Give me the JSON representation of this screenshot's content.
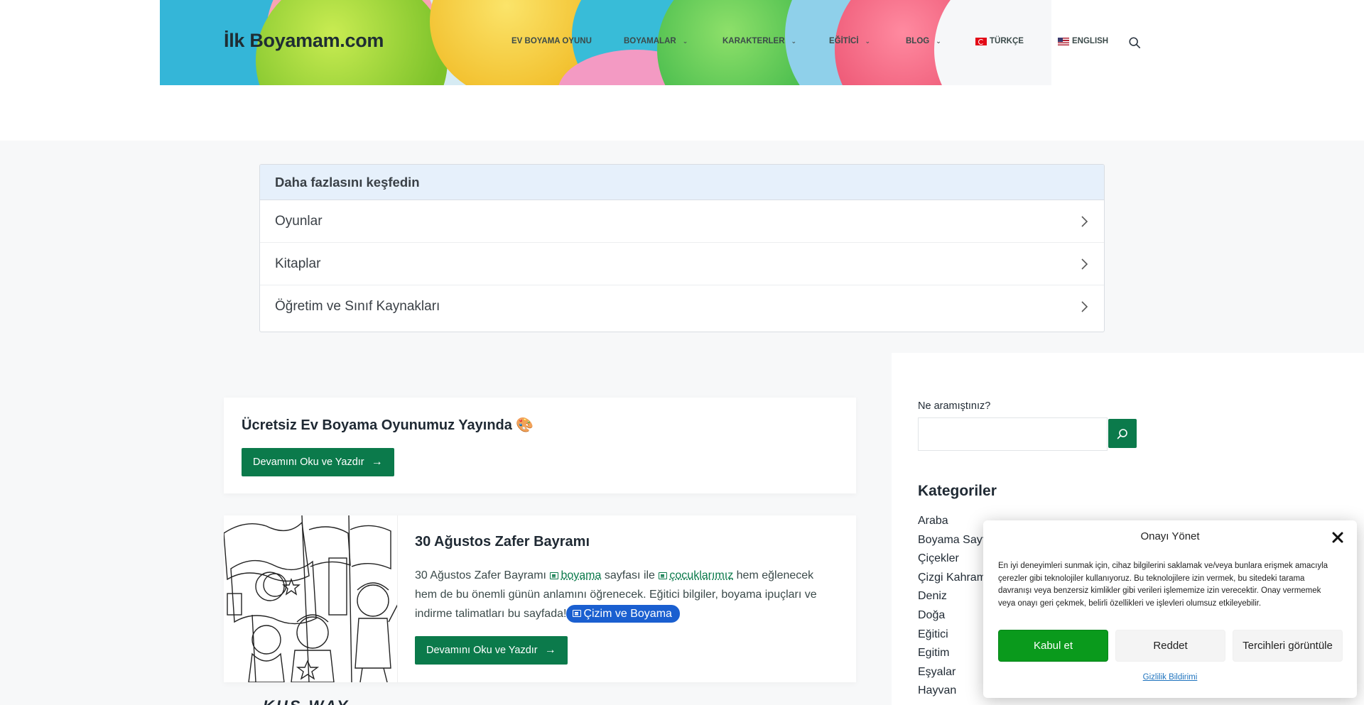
{
  "header": {
    "site_title": "İlk Boyamam.com",
    "nav": [
      {
        "label": "EV BOYAMA OYUNU",
        "has_dropdown": false
      },
      {
        "label": "BOYAMALAR",
        "has_dropdown": true
      },
      {
        "label": "KARAKTERLER",
        "has_dropdown": true
      },
      {
        "label": "EĞİTİCİ",
        "has_dropdown": true
      },
      {
        "label": "BLOG",
        "has_dropdown": true
      },
      {
        "label": "TÜRKÇE",
        "flag": "tr-flag-icon"
      },
      {
        "label": "ENGLISH",
        "flag": "us-flag-icon"
      }
    ],
    "search_icon": "search-icon"
  },
  "explore": {
    "title": "Daha fazlasını keşfedin",
    "items": [
      "Oyunlar",
      "Kitaplar",
      "Öğretim ve Sınıf Kaynakları"
    ]
  },
  "posts": [
    {
      "title": "Ücretsiz Ev Boyama Oyunumuz Yayında 🎨",
      "button": "Devamını Oku ve Yazdır"
    },
    {
      "title": "30 Ağustos Zafer Bayramı",
      "excerpt_pre": "30 Ağustos Zafer Bayramı",
      "link1": "boyama",
      "excerpt_mid": "sayfası ile",
      "link2": "çocuklarımız",
      "excerpt_post": "hem eğlenecek hem de bu önemli günün anlamını öğrenecek. Eğitici bilgiler, boyama ipuçları ve indirme talimatları bu sayfada!",
      "pill": "Çizim ve Boyama",
      "button": "Devamını Oku ve Yazdır"
    }
  ],
  "next_post_title": "KUŞ WAY",
  "sidebar": {
    "search_label": "Ne aramıştınız?",
    "search_value": "",
    "categories_heading": "Kategoriler",
    "categories": [
      "Araba",
      "Boyama Sayf",
      "Çiçekler",
      "Çizgi Kahram",
      "Deniz",
      "Doğa",
      "Eğitici",
      "Egitim",
      "Eşyalar",
      "Hayvan"
    ]
  },
  "consent": {
    "title": "Onayı Yönet",
    "body": "En iyi deneyimleri sunmak için, cihaz bilgilerini saklamak ve/veya bunlara erişmek amacıyla çerezler gibi teknolojiler kullanıyoruz. Bu teknolojilere izin vermek, bu sitedeki tarama davranışı veya benzersiz kimlikler gibi verileri işlememize izin verecektir. Onay vermemek veya onayı geri çekmek, belirli özellikleri ve işlevleri olumsuz etkileyebilir.",
    "accept": "Kabul et",
    "deny": "Reddet",
    "preferences": "Tercihleri görüntüle",
    "privacy": "Gizlilik Bildirimi"
  },
  "colors": {
    "brand_green": "#0b7a4b",
    "accept_green": "#0a9a1c",
    "pill_blue": "#1a5fd0",
    "explore_header": "#e6f0fb"
  }
}
